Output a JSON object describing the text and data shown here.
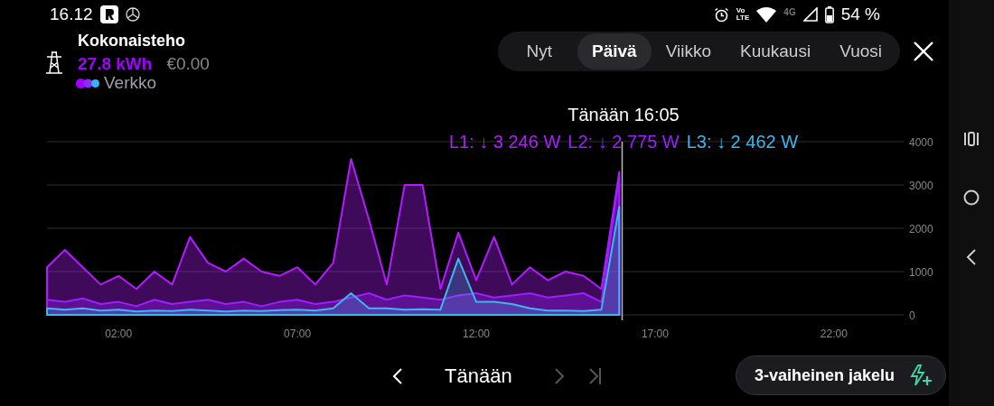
{
  "status_bar": {
    "time": "16.12",
    "volte": [
      "Vo",
      "LTE"
    ],
    "network": "4G",
    "battery": "54 %"
  },
  "header": {
    "title": "Kokonaisteho",
    "energy": "27.8 kWh",
    "cost": "€0.00",
    "legend": {
      "label": "Verkko",
      "dots": [
        {
          "color": "#a100ff"
        },
        {
          "color": "#8a2cff"
        },
        {
          "color": "#2fb6ff"
        }
      ]
    }
  },
  "tabs": [
    {
      "label": "Nyt",
      "selected": false
    },
    {
      "label": "Päivä",
      "selected": true
    },
    {
      "label": "Viikko",
      "selected": false
    },
    {
      "label": "Kuukausi",
      "selected": false
    },
    {
      "label": "Vuosi",
      "selected": false
    }
  ],
  "tooltip": {
    "title": "Tänään 16:05",
    "readings": [
      {
        "label": "L1:",
        "arrow": "↓",
        "value": "3 246 W",
        "color": "#b21cff"
      },
      {
        "label": "L2:",
        "arrow": "↓",
        "value": "2 775 W",
        "color": "#9b1fff"
      },
      {
        "label": "L3:",
        "arrow": "↓",
        "value": "2 462 W",
        "color": "#3ab8f0"
      }
    ]
  },
  "chart": {
    "chart_data": {
      "type": "area",
      "x": [
        0,
        0.5,
        1,
        1.5,
        2,
        2.5,
        3,
        3.5,
        4,
        4.5,
        5,
        5.5,
        6,
        6.5,
        7,
        7.5,
        8,
        8.5,
        9,
        9.5,
        10,
        10.5,
        11,
        11.5,
        12,
        12.5,
        13,
        13.5,
        14,
        14.5,
        15,
        15.5,
        16
      ],
      "series": [
        {
          "color": "#b21cff",
          "values": [
            1100,
            1500,
            1100,
            700,
            900,
            600,
            1000,
            700,
            1800,
            1200,
            1000,
            1300,
            1000,
            900,
            1100,
            700,
            1200,
            3600,
            2200,
            700,
            3000,
            3000,
            600,
            1900,
            800,
            1800,
            700,
            1100,
            800,
            1000,
            900,
            600,
            3300
          ]
        },
        {
          "color": "#9b1fff",
          "values": [
            350,
            300,
            380,
            250,
            300,
            200,
            350,
            250,
            300,
            350,
            250,
            300,
            200,
            300,
            350,
            250,
            300,
            400,
            500,
            350,
            450,
            400,
            350,
            450,
            500,
            400,
            450,
            500,
            400,
            450,
            500,
            300,
            3200
          ]
        },
        {
          "color": "#3ab8f0",
          "values": [
            150,
            120,
            150,
            100,
            120,
            80,
            100,
            90,
            120,
            100,
            80,
            100,
            90,
            110,
            120,
            100,
            150,
            500,
            150,
            150,
            120,
            130,
            120,
            1300,
            300,
            300,
            250,
            150,
            100,
            100,
            90,
            120,
            2500
          ]
        }
      ],
      "xlim": [
        0,
        24
      ],
      "ylim": [
        0,
        4000
      ],
      "xticks": [
        {
          "value": 2,
          "label": "02:00"
        },
        {
          "value": 7,
          "label": "07:00"
        },
        {
          "value": 12,
          "label": "12:00"
        },
        {
          "value": 17,
          "label": "17:00"
        },
        {
          "value": 22,
          "label": "22:00"
        }
      ],
      "yticks": [
        0,
        1000,
        2000,
        3000,
        4000
      ],
      "grid": true,
      "ref_lines": [
        {
          "axis": "x",
          "value": 16.08,
          "color": "#bbbbbb"
        }
      ]
    }
  },
  "nav": {
    "buttons": [
      {
        "kind": "prev",
        "disabled": false
      },
      {
        "kind": "label",
        "text": "Tänään"
      },
      {
        "kind": "next",
        "disabled": true
      },
      {
        "kind": "last",
        "disabled": true
      }
    ],
    "action": {
      "label": "3-vaiheinen jakelu"
    }
  }
}
